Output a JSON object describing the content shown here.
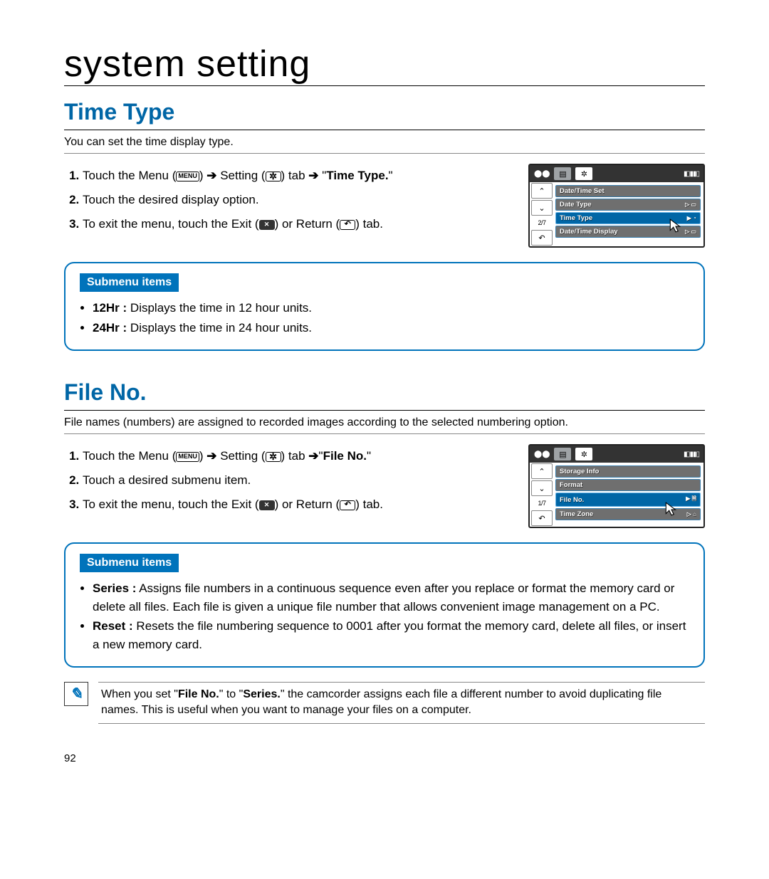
{
  "page_number": "92",
  "page_title": "system setting",
  "sections": [
    {
      "heading": "Time Type",
      "description": "You can set the time display type.",
      "steps": {
        "s1_a": "Touch the Menu (",
        "s1_b": ") ",
        "s1_c": " Setting (",
        "s1_d": ") tab ",
        "s1_e": " \"",
        "s1_target": "Time Type.",
        "s1_f": "\"",
        "s2": "Touch the desired display option.",
        "s3_a": "To exit the menu, touch the Exit (",
        "s3_b": ") or Return (",
        "s3_c": ") tab."
      },
      "screen": {
        "page_indicator": "2/7",
        "rows": [
          "Date/Time Set",
          "Date Type",
          "Time Type",
          "Date/Time Display"
        ],
        "selected_index": 2
      },
      "submenu_label": "Submenu items",
      "submenu": [
        {
          "name": "12Hr :",
          "desc": " Displays the time in 12 hour units."
        },
        {
          "name": "24Hr :",
          "desc": " Displays the time in 24 hour units."
        }
      ]
    },
    {
      "heading": "File No.",
      "description": "File names (numbers) are assigned to recorded images according to the selected numbering option.",
      "steps": {
        "s1_a": "Touch the Menu (",
        "s1_b": ") ",
        "s1_c": " Setting (",
        "s1_d": ") tab ",
        "s1_e": "\"",
        "s1_target": "File No.",
        "s1_f": "\"",
        "s2": "Touch a desired submenu item.",
        "s3_a": "To exit the menu, touch the Exit (",
        "s3_b": ") or Return (",
        "s3_c": ") tab."
      },
      "screen": {
        "page_indicator": "1/7",
        "rows": [
          "Storage Info",
          "Format",
          "File No.",
          "Time Zone"
        ],
        "selected_index": 2
      },
      "submenu_label": "Submenu items",
      "submenu": [
        {
          "name": "Series :",
          "desc": " Assigns file numbers in a continuous sequence even after you replace or format the memory card or delete all files. Each file is given a unique file number that allows convenient image management on a PC."
        },
        {
          "name": "Reset :",
          "desc": " Resets the file numbering sequence to 0001 after you format the memory card, delete all files, or insert a new memory card."
        }
      ]
    }
  ],
  "note": {
    "a": "When you set \"",
    "b": "File No.",
    "c": "\" to \"",
    "d": "Series.",
    "e": "\" the camcorder assigns each file a different number to avoid duplicating file names. This is useful when you want to manage your files on a computer."
  },
  "icons": {
    "menu_label": "MENU",
    "arrow": "➔"
  }
}
